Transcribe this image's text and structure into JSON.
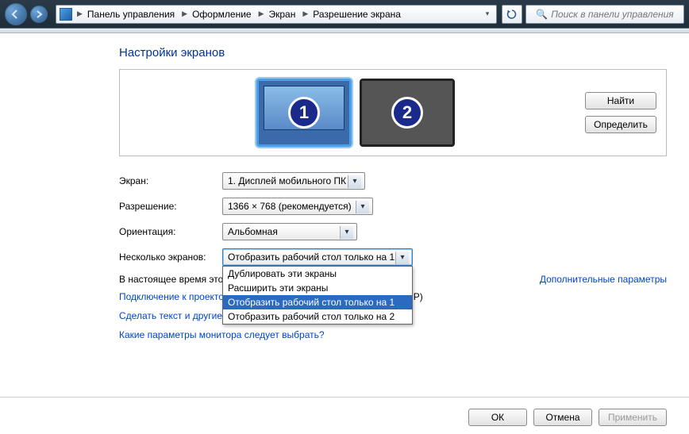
{
  "breadcrumb": {
    "items": [
      "Панель управления",
      "Оформление",
      "Экран",
      "Разрешение экрана"
    ]
  },
  "search": {
    "placeholder": "Поиск в панели управления"
  },
  "heading": "Настройки экранов",
  "panel_buttons": {
    "find": "Найти",
    "identify": "Определить"
  },
  "monitors": [
    {
      "num": "1",
      "selected": true
    },
    {
      "num": "2",
      "selected": false
    }
  ],
  "form": {
    "screen_label": "Экран:",
    "screen_value": "1. Дисплей мобильного ПК",
    "resolution_label": "Разрешение:",
    "resolution_value": "1366 × 768 (рекомендуется)",
    "orientation_label": "Ориентация:",
    "orientation_value": "Альбомная",
    "multi_label": "Несколько экранов:",
    "multi_value": "Отобразить рабочий стол только на 1",
    "multi_options": [
      "Дублировать эти экраны",
      "Расширить эти экраны",
      "Отобразить рабочий стол только на 1",
      "Отобразить рабочий стол только на 2"
    ],
    "multi_selected_index": 2
  },
  "current_line_prefix": "В настоящее время это",
  "advanced_link": "Дополнительные параметры",
  "projector_link": "Подключение к проектору",
  "projector_hint": "сь P)",
  "textsize_link": "Сделать текст и другие элементы больше или меньше",
  "whichmon_link": "Какие параметры монитора следует выбрать?",
  "footer": {
    "ok": "ОК",
    "cancel": "Отмена",
    "apply": "Применить"
  }
}
